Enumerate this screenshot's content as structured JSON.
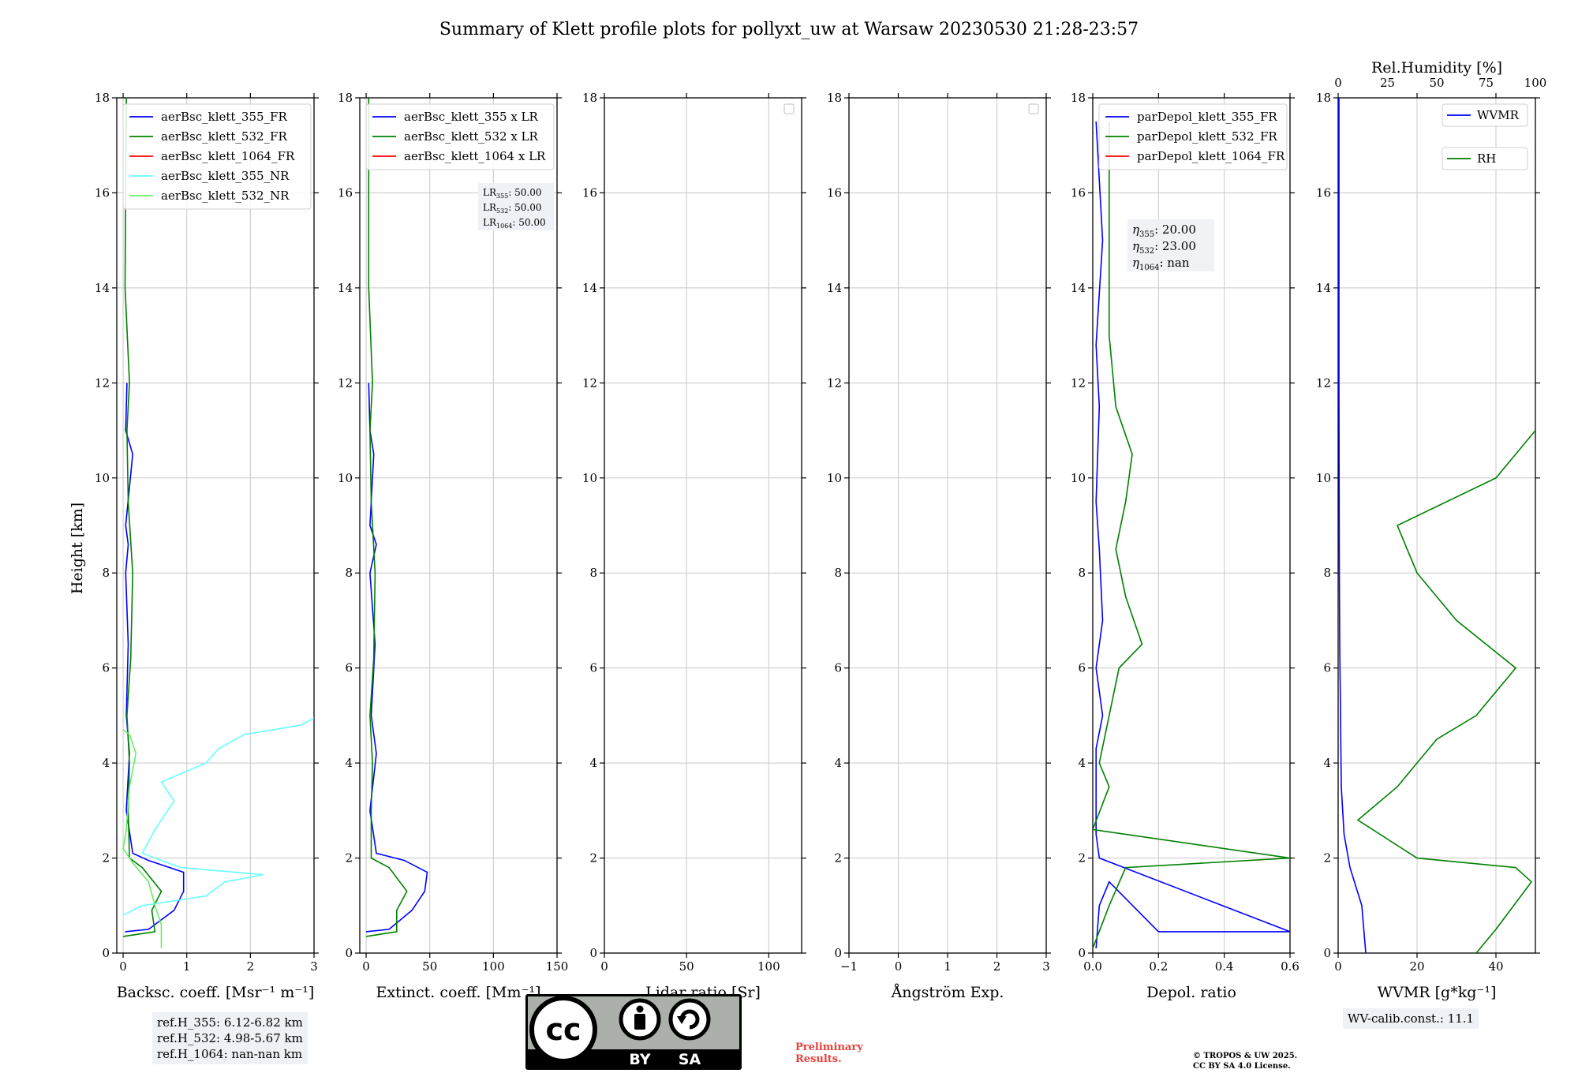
{
  "title": "Summary of Klett profile plots for pollyxt_uw at Warsaw 20230530 21:28-23:57",
  "ylabel": "Height [km]",
  "colors": {
    "c355": "#0000ff",
    "c532": "#008000",
    "c1064": "#ff0000",
    "c355nr": "#66ffff",
    "c532nr": "#66ee66"
  },
  "chart_data": [
    {
      "type": "line",
      "xlabel": "Backsc. coeff. [Msr⁻¹ m⁻¹]",
      "xlim": [
        -0.1,
        3
      ],
      "ylim": [
        0,
        18
      ],
      "xticks": [
        "0",
        "1",
        "2",
        "3"
      ],
      "yticks": [
        "0",
        "2",
        "4",
        "6",
        "8",
        "10",
        "12",
        "14",
        "16",
        "18"
      ],
      "legend_position": "top-left",
      "series": [
        {
          "name": "aerBsc_klett_355_FR",
          "color": "#0000ff",
          "x": [
            0.03,
            0.4,
            0.8,
            0.95,
            0.95,
            0.4,
            0.15,
            0.05,
            0.1,
            0.05,
            0.08,
            0.04,
            0.08,
            0.04,
            0.15,
            0.04,
            0.06
          ],
          "y": [
            0.45,
            0.5,
            0.9,
            1.3,
            1.7,
            1.95,
            2.1,
            3.0,
            4.2,
            5.0,
            6.5,
            8.0,
            8.6,
            9.0,
            10.5,
            11.0,
            12.0
          ]
        },
        {
          "name": "aerBsc_klett_532_FR",
          "color": "#008000",
          "x": [
            0.0,
            0.5,
            0.45,
            0.6,
            0.3,
            0.1,
            0.08,
            0.1,
            0.06,
            0.12,
            0.15,
            0.08,
            0.06,
            0.1,
            0.03,
            0.05
          ],
          "y": [
            0.35,
            0.45,
            0.9,
            1.3,
            1.8,
            2.0,
            3.0,
            4.0,
            5.0,
            6.2,
            8.0,
            9.5,
            11.0,
            12.0,
            14.0,
            18.0
          ]
        },
        {
          "name": "aerBsc_klett_1064_FR",
          "color": "#ff0000",
          "x": [],
          "y": []
        },
        {
          "name": "aerBsc_klett_355_NR",
          "color": "#66ffff",
          "x": [
            0.0,
            0.3,
            1.3,
            1.6,
            2.2,
            0.9,
            0.3,
            0.5,
            0.8,
            0.6,
            1.3,
            1.5,
            1.9,
            2.8,
            3.0
          ],
          "y": [
            0.8,
            1.0,
            1.2,
            1.5,
            1.65,
            1.8,
            2.1,
            2.6,
            3.2,
            3.6,
            4.0,
            4.3,
            4.6,
            4.8,
            4.95
          ]
        },
        {
          "name": "aerBsc_klett_532_NR",
          "color": "#66ee66",
          "x": [
            0.6,
            0.6,
            0.5,
            0.4,
            0.15,
            0.0,
            0.05,
            0.1,
            0.2,
            0.1,
            0.0
          ],
          "y": [
            0.1,
            0.6,
            1.0,
            1.5,
            1.9,
            2.2,
            2.6,
            3.5,
            4.2,
            4.6,
            4.7
          ]
        }
      ]
    },
    {
      "type": "line",
      "xlabel": "Extinct. coeff. [Mm⁻¹]",
      "xlim": [
        -5,
        150
      ],
      "ylim": [
        0,
        18
      ],
      "xticks": [
        "0",
        "50",
        "100",
        "150"
      ],
      "yticks": [
        "0",
        "2",
        "4",
        "6",
        "8",
        "10",
        "12",
        "14",
        "16",
        "18"
      ],
      "legend_position": "top-left",
      "lr": {
        "LR355": "50.00",
        "LR532": "50.00",
        "LR1064": "50.00"
      },
      "series": [
        {
          "name": "aerBsc_klett_355 x LR",
          "color": "#0000ff",
          "x": [
            0,
            18,
            36,
            46,
            48,
            30,
            8,
            3,
            8,
            4,
            7,
            3,
            8,
            3,
            6,
            3,
            2
          ],
          "y": [
            0.45,
            0.5,
            0.9,
            1.3,
            1.7,
            1.95,
            2.1,
            3.0,
            4.2,
            5.0,
            6.5,
            8.0,
            8.6,
            9.0,
            10.5,
            11.0,
            12.0
          ]
        },
        {
          "name": "aerBsc_klett_532 x LR",
          "color": "#008000",
          "x": [
            0,
            24,
            24,
            32,
            18,
            4,
            4,
            5,
            3,
            6,
            7,
            4,
            3,
            5,
            2,
            2
          ],
          "y": [
            0.35,
            0.45,
            0.9,
            1.3,
            1.8,
            2.0,
            3.0,
            4.0,
            5.0,
            6.2,
            8.0,
            9.5,
            11.0,
            12.0,
            14.0,
            18.0
          ]
        },
        {
          "name": "aerBsc_klett_1064 x LR",
          "color": "#ff0000",
          "x": [],
          "y": []
        }
      ]
    },
    {
      "type": "line",
      "xlabel": "Lidar ratio [Sr]",
      "xlim": [
        0,
        120
      ],
      "ylim": [
        0,
        18
      ],
      "xticks": [
        "0",
        "50",
        "100"
      ],
      "yticks": [
        "0",
        "2",
        "4",
        "6",
        "8",
        "10",
        "12",
        "14",
        "16",
        "18"
      ],
      "series": []
    },
    {
      "type": "line",
      "xlabel": "Ångström Exp.",
      "xlim": [
        -1,
        3
      ],
      "ylim": [
        0,
        18
      ],
      "xticks": [
        "−1",
        "0",
        "1",
        "2",
        "3"
      ],
      "yticks": [
        "0",
        "2",
        "4",
        "6",
        "8",
        "10",
        "12",
        "14",
        "16",
        "18"
      ],
      "series": []
    },
    {
      "type": "line",
      "xlabel": "Depol. ratio",
      "xlim": [
        0,
        0.6
      ],
      "ylim": [
        0,
        18
      ],
      "xticks": [
        "0.0",
        "0.2",
        "0.4",
        "0.6"
      ],
      "yticks": [
        "0",
        "2",
        "4",
        "6",
        "8",
        "10",
        "12",
        "14",
        "16",
        "18"
      ],
      "legend_position": "top-left",
      "eta": {
        "eta355": "20.00",
        "eta532": "23.00",
        "eta1064": "nan"
      },
      "series": [
        {
          "name": "parDepol_klett_355_FR",
          "color": "#0000ff",
          "x": [
            0.01,
            0.02,
            0.05,
            0.2,
            0.6,
            0.02,
            0.01,
            0.01,
            0.03,
            0.01,
            0.03,
            0.02,
            0.01,
            0.02,
            0.01,
            0.03,
            0.01
          ],
          "y": [
            0.1,
            1.0,
            1.5,
            0.45,
            0.45,
            2.0,
            2.5,
            4.3,
            5.0,
            6.0,
            7.0,
            8.5,
            9.5,
            11.5,
            12.8,
            15.0,
            17.5
          ]
        },
        {
          "name": "parDepol_klett_532_FR",
          "color": "#008000",
          "x": [
            0.0,
            0.05,
            0.1,
            0.6,
            0.0,
            0.05,
            0.02,
            0.05,
            0.08,
            0.15,
            0.1,
            0.07,
            0.1,
            0.12,
            0.07,
            0.05,
            0.05
          ],
          "y": [
            0.1,
            1.0,
            1.8,
            2.0,
            2.6,
            3.5,
            4.0,
            5.0,
            6.0,
            6.5,
            7.5,
            8.5,
            9.5,
            10.5,
            11.5,
            13.0,
            17.5
          ]
        },
        {
          "name": "parDepol_klett_1064_FR",
          "color": "#ff0000",
          "x": [],
          "y": []
        }
      ]
    },
    {
      "type": "line",
      "xlabel": "WVMR [g*kg⁻¹]",
      "x2label": "Rel.Humidity [%]",
      "xlim": [
        0,
        50
      ],
      "x2lim": [
        0,
        100
      ],
      "ylim": [
        0,
        18
      ],
      "xticks": [
        "0",
        "20",
        "40"
      ],
      "x2ticks": [
        "0",
        "25",
        "50",
        "75",
        "100"
      ],
      "yticks": [
        "0",
        "2",
        "4",
        "6",
        "8",
        "10",
        "12",
        "14",
        "16",
        "18"
      ],
      "legend_position": "top-right",
      "wv_calib": "WV-calib.const.: 11.1",
      "series": [
        {
          "name": "WVMR",
          "color": "#0000ff",
          "x": [
            7,
            6,
            3,
            1.5,
            0.8,
            0.6,
            0.4,
            0.3,
            0.2,
            0.2
          ],
          "y": [
            0.0,
            1.0,
            1.8,
            2.5,
            3.5,
            5.0,
            6.5,
            8.0,
            12.0,
            18.0
          ]
        },
        {
          "name": "RH",
          "color": "#008000",
          "x": [
            70,
            80,
            98,
            90,
            40,
            10,
            30,
            50,
            70,
            90,
            60,
            40,
            30,
            80,
            100
          ],
          "y": [
            0.0,
            0.5,
            1.5,
            1.8,
            2.0,
            2.8,
            3.5,
            4.5,
            5.0,
            6.0,
            7.0,
            8.0,
            9.0,
            10.0,
            11.0
          ]
        }
      ]
    }
  ],
  "ref_heights": [
    "ref.H_355: 6.12-6.82 km",
    "ref.H_532: 4.98-5.67 km",
    "ref.H_1064: nan-nan km"
  ],
  "cc_badge": {
    "by": "BY",
    "sa": "SA"
  },
  "preliminary": [
    "Preliminary",
    "Results."
  ],
  "copyright": [
    "© TROPOS & UW 2025.",
    "CC BY SA 4.0 License."
  ]
}
